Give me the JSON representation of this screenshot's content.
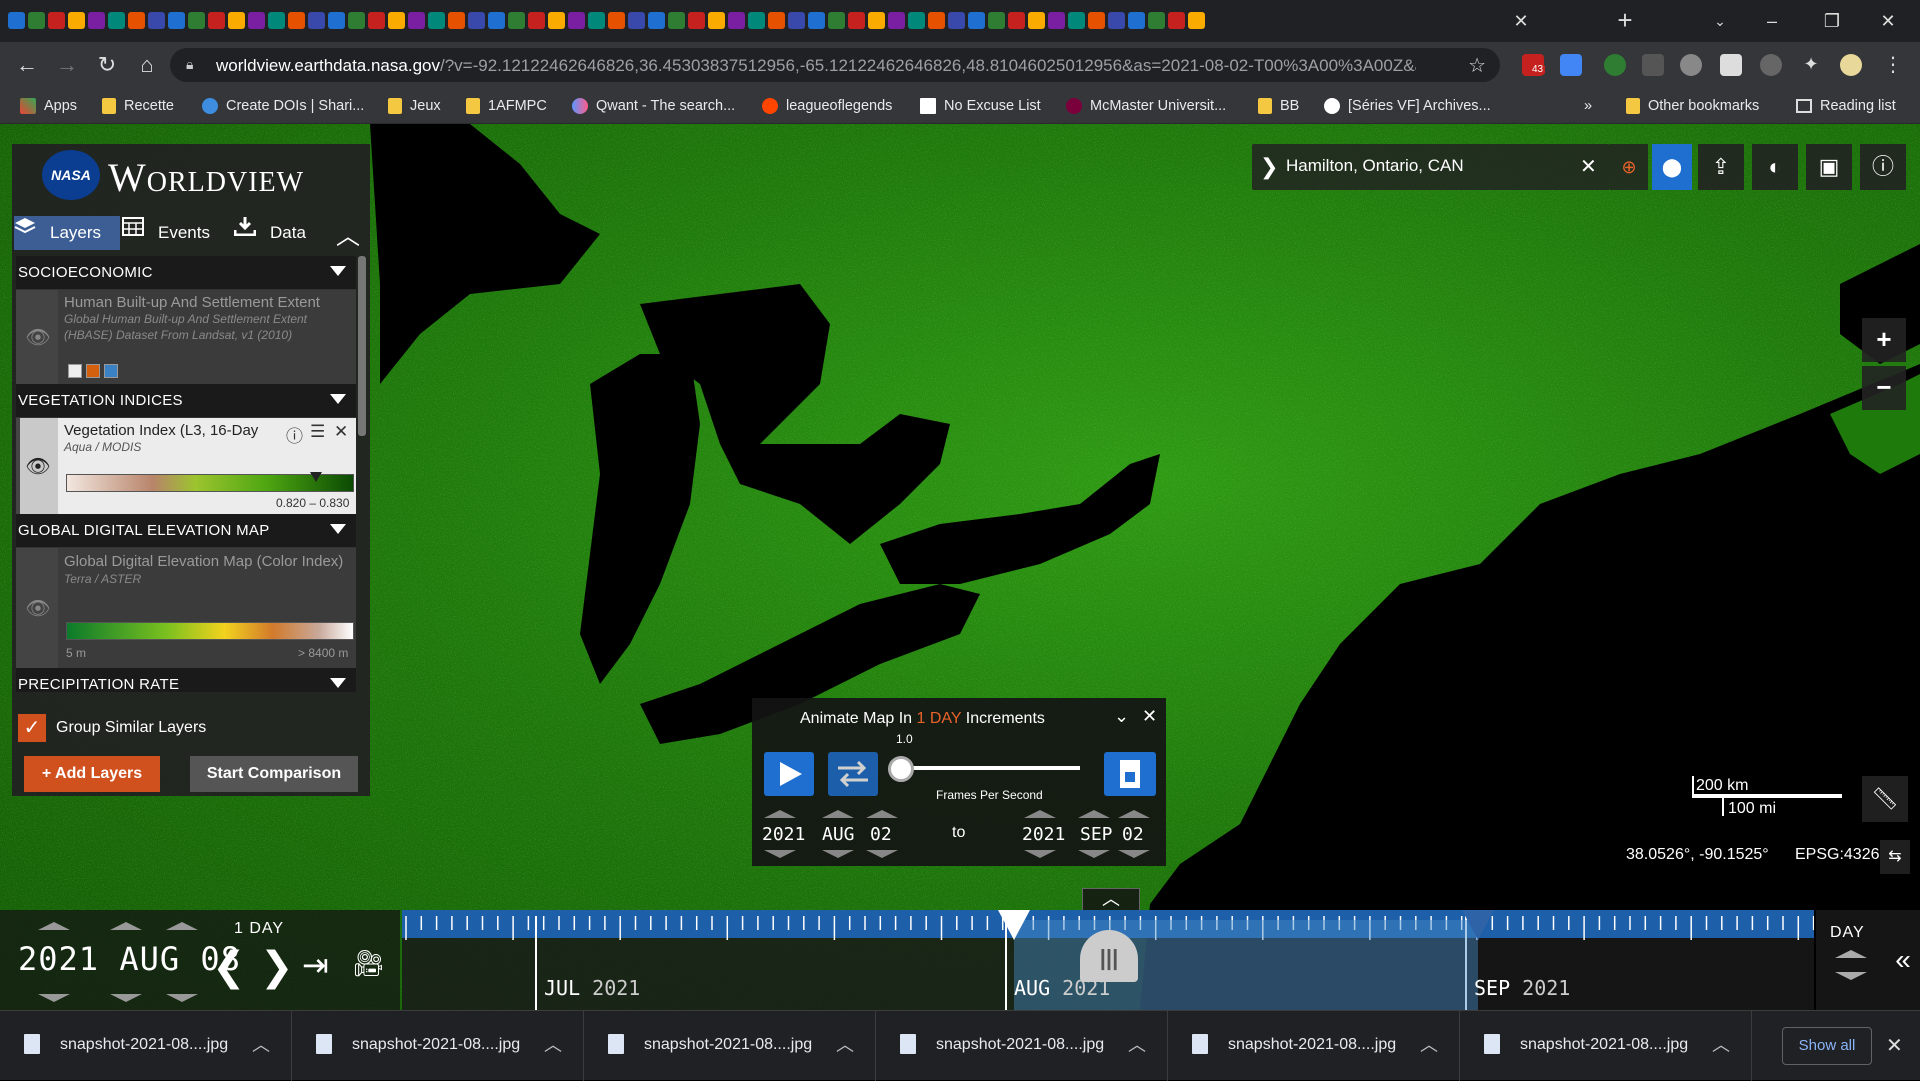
{
  "browser": {
    "url_main": "worldview.earthdata.nasa.gov",
    "url_rest": "/?v=-92.12122462646826,36.45303837512956,-65.12122462646826,48.81046025012956&as=2021-08-02-T00%3A00%3A00Z&ae...",
    "bookmarks": [
      "Apps",
      "Recette",
      "Create DOIs | Shari...",
      "Jeux",
      "1AFMPC",
      "Qwant - The search...",
      "leagueoflegends",
      "No Excuse List",
      "McMaster Universit...",
      "BB",
      "[Séries VF] Archives...",
      "Other bookmarks",
      "Reading list"
    ],
    "ext_badge": "43"
  },
  "app": {
    "title": "Worldview",
    "logo_text": "NASA",
    "tabs": {
      "layers": "Layers",
      "events": "Events",
      "data": "Data"
    }
  },
  "layers": {
    "categories": [
      "SOCIOECONOMIC",
      "VEGETATION INDICES",
      "GLOBAL DIGITAL ELEVATION MAP",
      "PRECIPITATION RATE"
    ],
    "hbase": {
      "name": "Human Built-up And Settlement Extent",
      "sub": "Global Human Built-up And Settlement Extent (HBASE) Dataset From Landsat, v1 (2010)"
    },
    "veg": {
      "name": "Vegetation Index (L3, 16-Day",
      "sub": "Aqua / MODIS",
      "range": "0.820 – 0.830"
    },
    "dem": {
      "name": "Global Digital Elevation Map (Color Index)",
      "sub": "Terra / ASTER",
      "min": "5 m",
      "max": "> 8400 m"
    },
    "group_label": "Group Similar Layers",
    "add_label": "+ Add Layers",
    "compare_label": "Start Comparison"
  },
  "location": {
    "text": "Hamilton, Ontario, CAN"
  },
  "animation": {
    "prefix": "Animate Map In",
    "count": "1",
    "unit": "DAY",
    "suffix": "Increments",
    "fps": "1.0",
    "fps_label": "Frames Per Second",
    "to": "to",
    "start": {
      "year": "2021",
      "month": "AUG",
      "day": "02"
    },
    "end": {
      "year": "2021",
      "month": "SEP",
      "day": "02"
    }
  },
  "scale": {
    "km": "200 km",
    "mi": "100 mi"
  },
  "coords": "38.0526°, -90.1525°",
  "epsg": "EPSG:4326",
  "timeline": {
    "date": "2021 AUG 08",
    "increment": "1 DAY",
    "zoom": "DAY",
    "months": [
      {
        "m": "JUL",
        "y": "2021"
      },
      {
        "m": "AUG",
        "y": "2021"
      },
      {
        "m": "SEP",
        "y": "2021"
      }
    ]
  },
  "downloads": {
    "files": [
      "snapshot-2021-08....jpg",
      "snapshot-2021-08....jpg",
      "snapshot-2021-08....jpg",
      "snapshot-2021-08....jpg",
      "snapshot-2021-08....jpg",
      "snapshot-2021-08....jpg"
    ],
    "show_all": "Show all"
  }
}
